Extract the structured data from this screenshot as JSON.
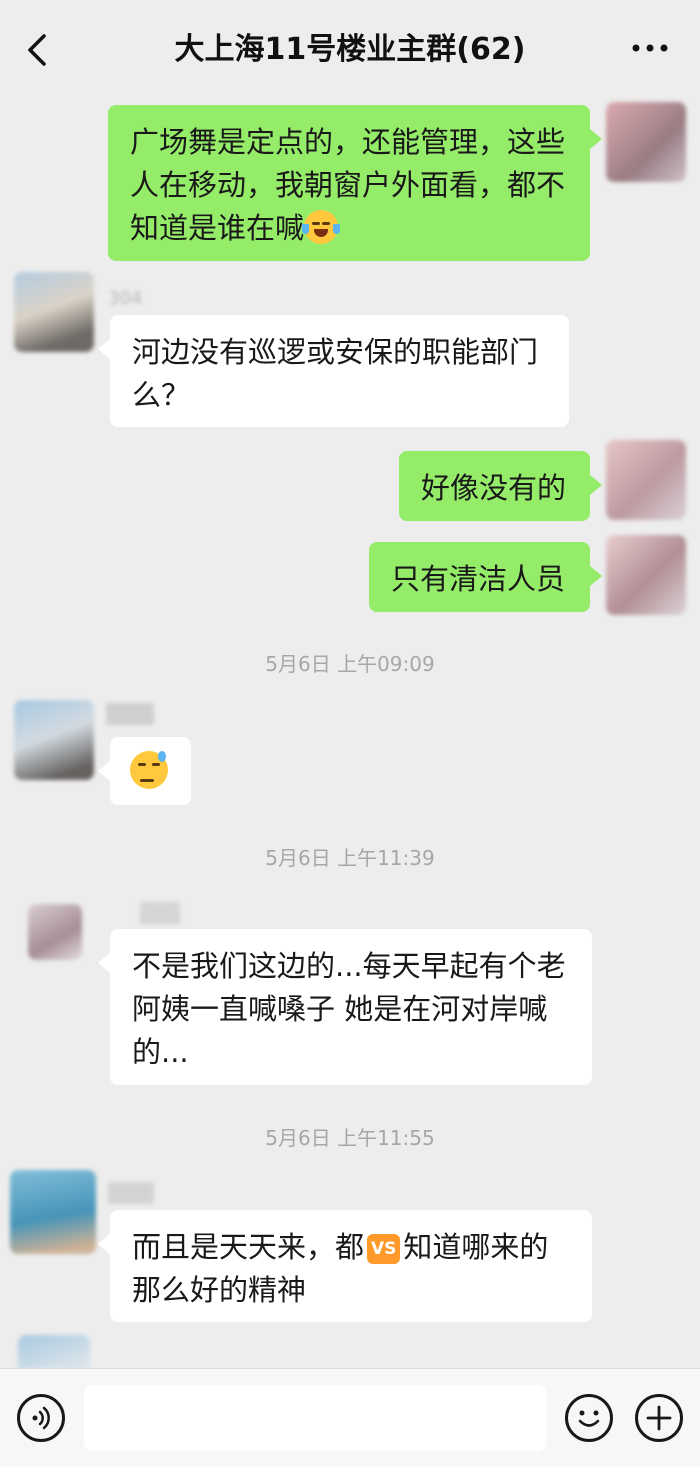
{
  "header": {
    "title": "大上海11号楼业主群(62)",
    "back_icon": "chevron-left-icon",
    "more_icon": "more-dots-icon"
  },
  "messages": [
    {
      "direction": "out",
      "text": "广场舞是定点的，还能管理，这些人在移动，我朝窗户外面看，都不知道是谁在喊",
      "emoji": "laugh-tears-emoji"
    },
    {
      "direction": "in",
      "sender": "304",
      "text": "河边没有巡逻或安保的职能部门么？"
    },
    {
      "direction": "out",
      "text": "好像没有的"
    },
    {
      "direction": "out",
      "text": "只有清洁人员"
    },
    {
      "direction": "in",
      "emoji": "sweat-face-emoji"
    },
    {
      "direction": "in",
      "text": "不是我们这边的...每天早起有个老阿姨一直喊嗓子 她是在河对岸喊的..."
    },
    {
      "direction": "in",
      "text_before": "而且是天天来，都",
      "badge": "VS",
      "text_after": "知道哪来的那么好的精神"
    }
  ],
  "timestamps": [
    "5月6日 上午09:09",
    "5月6日 上午11:39",
    "5月6日 上午11:55"
  ],
  "input_bar": {
    "voice_icon": "voice-icon",
    "emoji_icon": "smiley-icon",
    "plus_icon": "plus-icon",
    "input_value": ""
  }
}
